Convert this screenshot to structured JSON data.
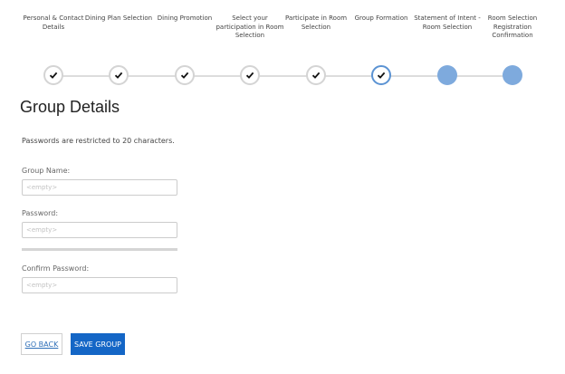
{
  "steps": [
    {
      "label": "Personal & Contact Details",
      "state": "done"
    },
    {
      "label": "Dining Plan Selection",
      "state": "done"
    },
    {
      "label": "Dining Promotion",
      "state": "done"
    },
    {
      "label": "Select your participation in Room Selection",
      "state": "done"
    },
    {
      "label": "Participate in Room Selection",
      "state": "done"
    },
    {
      "label": "Group Formation",
      "state": "current"
    },
    {
      "label": "Statement of Intent - Room Selection",
      "state": "todo"
    },
    {
      "label": "Room Selection Registration Confirmation",
      "state": "todo"
    }
  ],
  "icons": {
    "done": "checkmark-icon",
    "current": "checkmark-icon"
  },
  "colors": {
    "accent": "#1466c6",
    "step_current_border": "#5b93d3",
    "step_todo": "#7eaadd"
  },
  "page": {
    "title": "Group Details",
    "note": "Passwords are restricted to 20 characters."
  },
  "form": {
    "group_name": {
      "label": "Group Name:",
      "placeholder": "<empty>",
      "value": ""
    },
    "password": {
      "label": "Password:",
      "placeholder": "<empty>",
      "value": ""
    },
    "confirm_password": {
      "label": "Confirm Password:",
      "placeholder": "<empty>",
      "value": ""
    }
  },
  "buttons": {
    "back": "GO BACK",
    "save": "SAVE GROUP"
  }
}
